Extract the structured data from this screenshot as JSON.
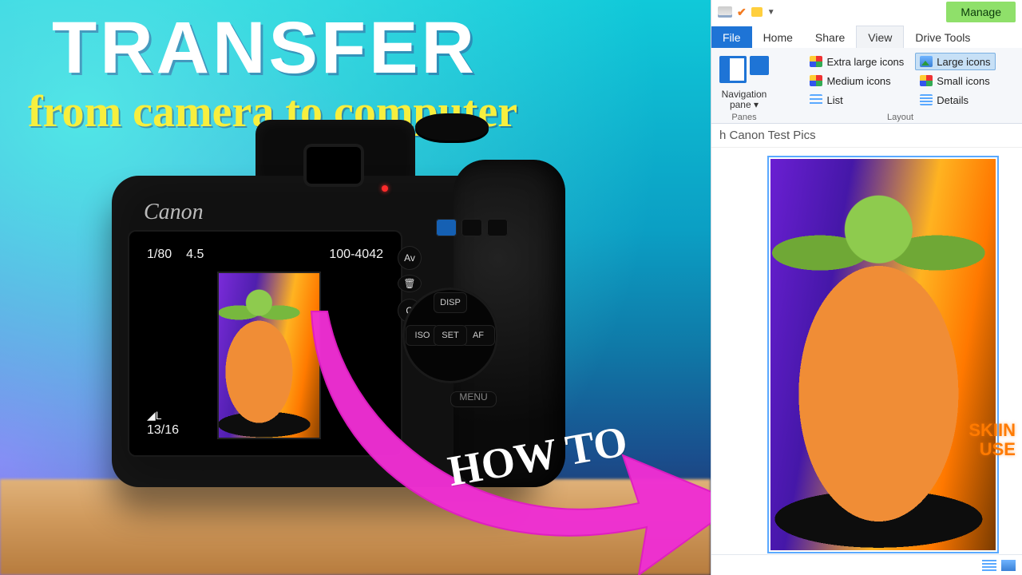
{
  "title": "TRANSFER",
  "subtitle": "from camera to computer",
  "arrow_text": "HOW TO",
  "camera": {
    "brand": "Canon",
    "shutter": "1/80",
    "aperture": "4.5",
    "image_no": "100-4042",
    "quality": "L",
    "counter": "13/16",
    "buttons": {
      "av": "Av",
      "trash": "🗑",
      "q": "Q",
      "disp": "DISP",
      "iso": "ISO",
      "set": "SET",
      "af": "AF",
      "menu": "MENU"
    }
  },
  "explorer": {
    "manage": "Manage",
    "tabs": {
      "file": "File",
      "home": "Home",
      "share": "Share",
      "view": "View",
      "drive": "Drive Tools"
    },
    "panes": {
      "nav": "Navigation",
      "pane": "pane ▾",
      "group": "Panes"
    },
    "layout": {
      "xl": "Extra large icons",
      "lg": "Large icons",
      "md": "Medium icons",
      "sm": "Small icons",
      "list": "List",
      "details": "Details",
      "group": "Layout"
    },
    "breadcrumb": "h Canon Test Pics",
    "side_label_1": "SKIIN",
    "side_label_2": "USE"
  }
}
